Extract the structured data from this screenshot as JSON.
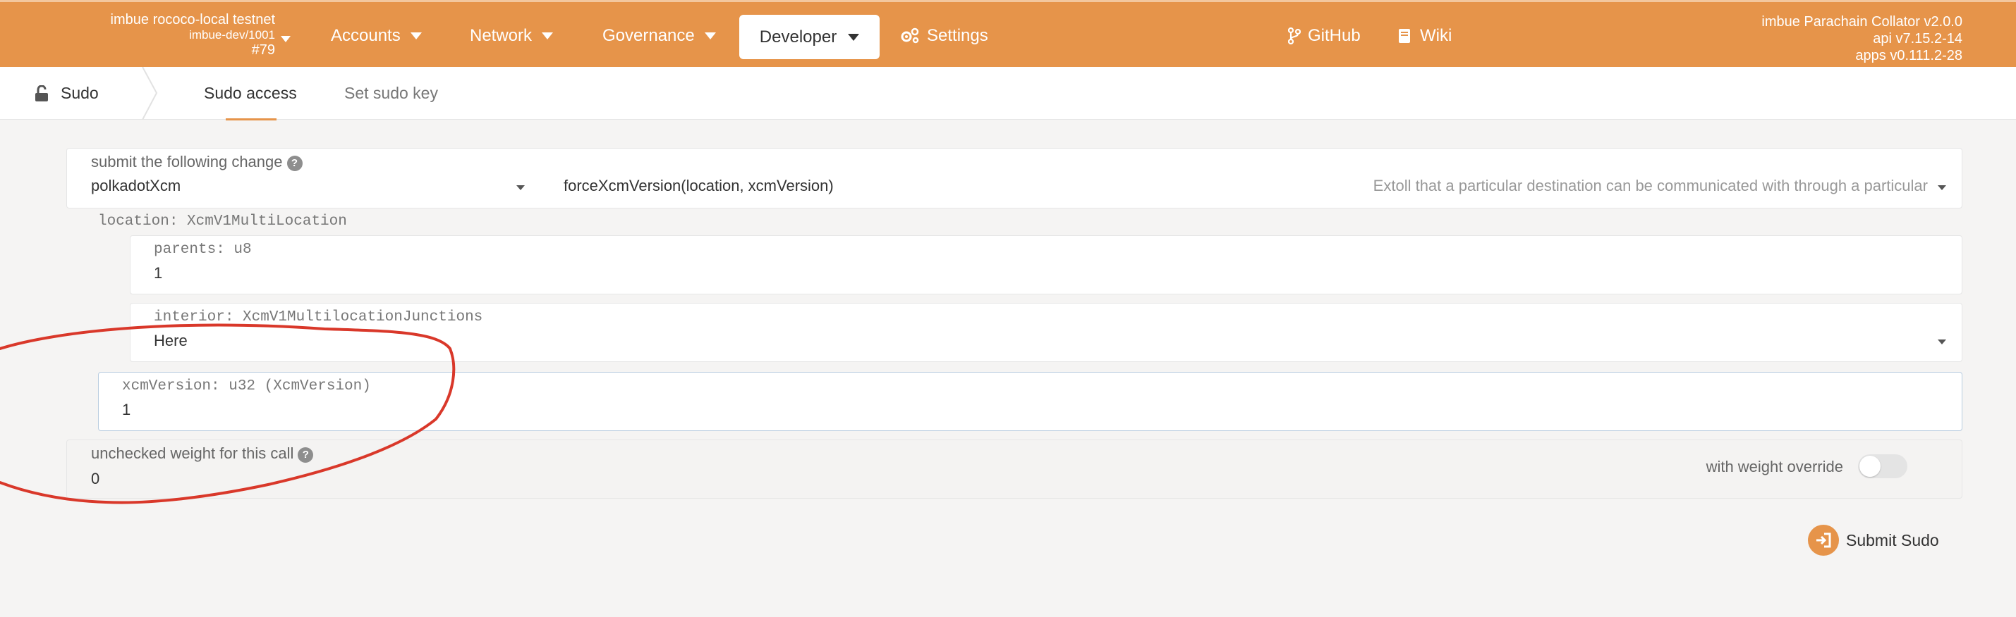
{
  "header": {
    "chain_name": "imbue rococo-local testnet",
    "chain_sub": "imbue-dev/1001",
    "block": "#79",
    "nav": {
      "accounts": "Accounts",
      "network": "Network",
      "governance": "Governance",
      "developer": "Developer",
      "settings": "Settings",
      "github": "GitHub",
      "wiki": "Wiki"
    },
    "version": {
      "line1": "imbue Parachain Collator v2.0.0",
      "line2": "api v7.15.2-14",
      "line3": "apps v0.111.2-28"
    }
  },
  "subnav": {
    "section": "Sudo",
    "tabs": [
      "Sudo access",
      "Set sudo key"
    ]
  },
  "form": {
    "change_label": "submit the following change",
    "pallet": "polkadotXcm",
    "call": "forceXcmVersion(location, xcmVersion)",
    "call_doc": "Extoll that a particular destination can be communicated with through a particular",
    "location_label": "location: XcmV1MultiLocation",
    "parents_label": "parents: u8",
    "parents_value": "1",
    "interior_label": "interior: XcmV1MultilocationJunctions",
    "interior_value": "Here",
    "xcm_label": "xcmVersion: u32 (XcmVersion)",
    "xcm_value": "1",
    "weight_label": "unchecked weight for this call",
    "weight_value": "0",
    "override_label": "with weight override",
    "override_on": false
  },
  "actions": {
    "submit": "Submit Sudo"
  },
  "colors": {
    "accent": "#e6944a",
    "annotation": "#d9382a"
  },
  "icons": [
    "chevron-down-icon",
    "gear-icon",
    "github-icon",
    "book-icon",
    "lock-icon",
    "help-icon",
    "sign-in-icon"
  ]
}
